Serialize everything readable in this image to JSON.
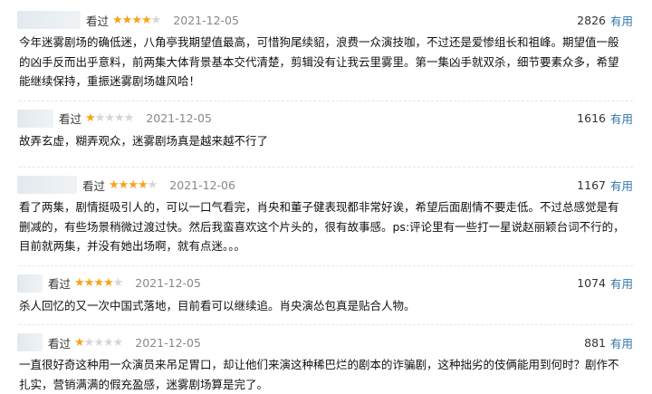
{
  "reviews": [
    {
      "status": "看过",
      "rating": 4,
      "date": "2021-12-05",
      "votes": "2826",
      "useful_label": "有用",
      "content": "今年迷雾剧场的确低迷，八角亭我期望值最高，可惜狗尾续貂，浪费一众演技咖，不过还是爱惨组长和祖峰。期望值一般的凶手反而出乎意料，前两集大体背景基本交代清楚，剪辑没有让我云里雾里。第一集凶手就双杀，细节要素众多，希望能继续保持，重振迷雾剧场雄风哈！"
    },
    {
      "status": "看过",
      "rating": 1,
      "date": "2021-12-05",
      "votes": "1616",
      "useful_label": "有用",
      "content": "故弄玄虚，糊弄观众，迷雾剧场真是越来越不行了"
    },
    {
      "status": "看过",
      "rating": 4,
      "date": "2021-12-06",
      "votes": "1167",
      "useful_label": "有用",
      "content": "看了两集，剧情挺吸引人的，可以一口气看完，肖央和董子健表现都非常好诶，希望后面剧情不要走低。不过总感觉是有删减的，有些场景稍微过渡过快。然后我蛮喜欢这个片头的，很有故事感。ps:评论里有一些打一星说赵丽颖台词不行的，目前就两集，并没有她出场啊，就有点迷。。。"
    },
    {
      "status": "看过",
      "rating": 4,
      "date": "2021-12-05",
      "votes": "1074",
      "useful_label": "有用",
      "content": "杀人回忆的又一次中国式落地，目前看可以继续追。肖央演怂包真是贴合人物。"
    },
    {
      "status": "看过",
      "rating": 1,
      "date": "2021-12-05",
      "votes": "881",
      "useful_label": "有用",
      "content": "一直很好奇这种用一众演员来吊足胃口，却让他们来演这种稀巴烂的剧本的诈骗剧，这种拙劣的伎俩能用到何时？剧作不扎实，营销满满的假充盈感，迷雾剧场算是完了。"
    }
  ]
}
